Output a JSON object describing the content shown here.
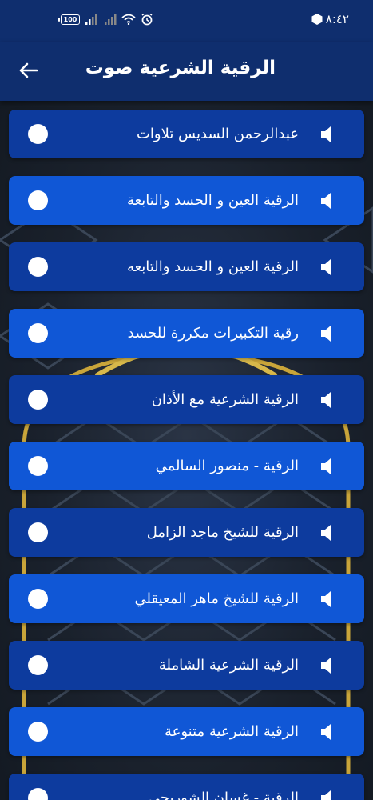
{
  "status_bar": {
    "time": "٨:٤٢",
    "battery": "100"
  },
  "app_bar": {
    "title": "الرقية الشرعية صوت",
    "back_icon": "arrow-left-icon"
  },
  "colors": {
    "bar": "#0f2e6e",
    "item_dark": "#0d3b9e",
    "item_bright": "#1057d6",
    "accent_gold": "#d8b84a"
  },
  "items": [
    {
      "label": "عبدالرحمن السديس تلاوات",
      "style": "dark"
    },
    {
      "label": "الرقية العين و الحسد والتابعة",
      "style": "bright"
    },
    {
      "label": "الرقية العين و الحسد والتابعه",
      "style": "dark"
    },
    {
      "label": "رقية التكبيرات مكررة للحسد",
      "style": "bright"
    },
    {
      "label": "الرقية الشرعية مع الأذان",
      "style": "dark"
    },
    {
      "label": "الرقية - منصور السالمي",
      "style": "bright"
    },
    {
      "label": "الرقية للشيخ ماجد الزامل",
      "style": "dark"
    },
    {
      "label": "الرقية للشيخ ماهر المعيقلي",
      "style": "bright"
    },
    {
      "label": "الرقية الشرعية الشاملة",
      "style": "dark"
    },
    {
      "label": "الرقية الشرعية متنوعة",
      "style": "bright"
    },
    {
      "label": "الرقية - غسان الشوربجي",
      "style": "dark"
    }
  ]
}
